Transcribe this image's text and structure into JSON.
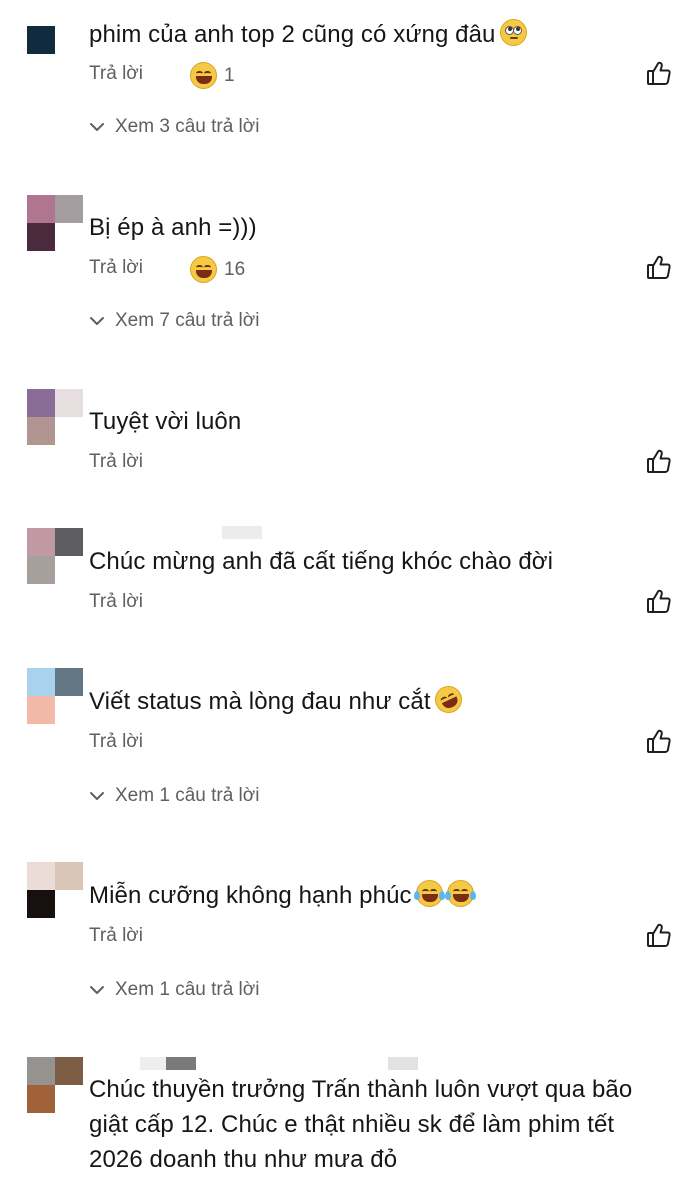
{
  "comments": [
    {
      "text": "phim của anh top 2 cũng có xứng đâu",
      "emojis": [
        "roll-eyes-emoji"
      ],
      "reply_label": "Trả lời",
      "reaction_count": "1",
      "reaction_emoji": "grinning-emoji",
      "view_replies": "Xem 3 câu trả lời",
      "avatar_colors": [
        "#102b3d",
        "#ffffff",
        "#ffffff",
        "#ffffff"
      ]
    },
    {
      "text": "Bị ép à anh =)))",
      "emojis": [],
      "reply_label": "Trả lời",
      "reaction_count": "16",
      "reaction_emoji": "grinning-emoji",
      "view_replies": "Xem 7 câu trả lời",
      "avatar_colors": [
        "#b07690",
        "#a39da0",
        "#4a2a3c",
        "#ffffff"
      ]
    },
    {
      "text": "Tuyệt vời luôn",
      "emojis": [],
      "reply_label": "Trả lời",
      "reaction_count": "",
      "view_replies": "",
      "avatar_colors": [
        "#8a6c99",
        "#e7dfdf",
        "#b19590",
        "#ffffff"
      ]
    },
    {
      "text": "Chúc mừng anh đã cất tiếng khóc chào đời",
      "emojis": [],
      "reply_label": "Trả lời",
      "reaction_count": "",
      "view_replies": "",
      "avatar_colors": [
        "#c099a5",
        "#5d5c60",
        "#a69f9b",
        "#ffffff"
      ]
    },
    {
      "text": "Viết status mà lòng đau như cắt",
      "emojis": [
        "rofl-emoji"
      ],
      "reply_label": "Trả lời",
      "reaction_count": "",
      "view_replies": "Xem 1 câu trả lời",
      "avatar_colors": [
        "#a9d2ee",
        "#627783",
        "#f2b9a9",
        "#ffffff"
      ]
    },
    {
      "text": "Miễn cưỡng không hạnh phúc",
      "emojis": [
        "tears-of-joy-emoji",
        "tears-of-joy-emoji"
      ],
      "reply_label": "Trả lời",
      "reaction_count": "",
      "view_replies": "Xem 1 câu trả lời",
      "avatar_colors": [
        "#ecdcd7",
        "#d9c6b9",
        "#16110f",
        "#ffffff"
      ]
    },
    {
      "text": "Chúc thuyền trưởng Trấn thành luôn vượt qua bão giật cấp 12. Chúc e thật nhiều sk để  làm phim tết 2026 doanh thu như mưa đỏ",
      "emojis": [],
      "reply_label": "",
      "reaction_count": "",
      "view_replies": "",
      "avatar_colors": [
        "#959390",
        "#7c5c44",
        "#a26239",
        "#ffffff"
      ]
    }
  ],
  "colors": {
    "text": "#161616",
    "secondary": "#5f5f5f",
    "background": "#ffffff"
  },
  "icons": {
    "like": "thumbs-up-icon",
    "expand": "chevron-down-icon"
  }
}
